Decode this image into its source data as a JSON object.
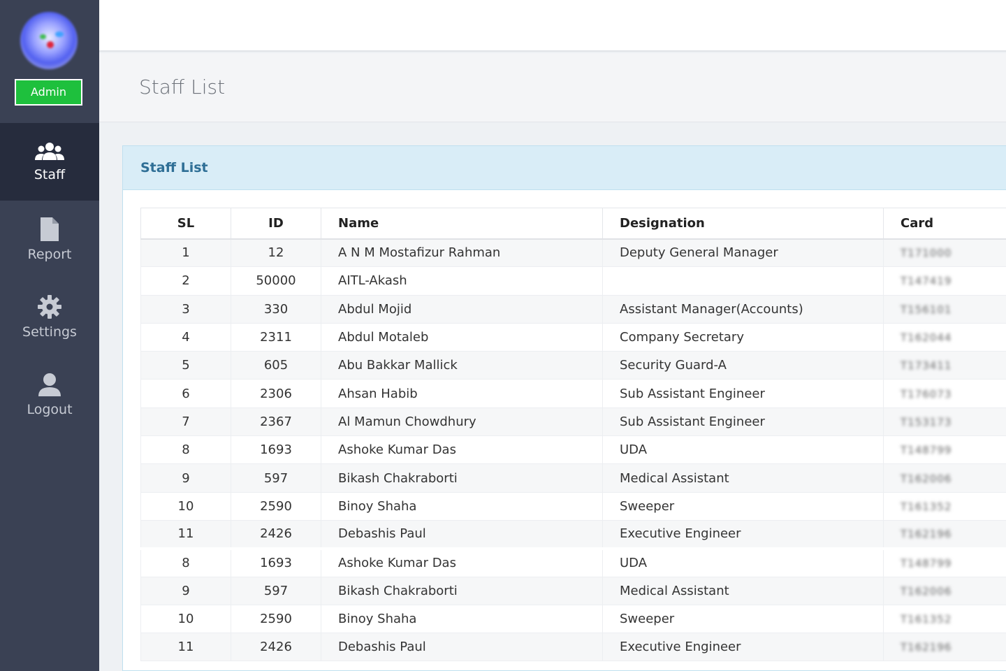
{
  "sidebar": {
    "admin_badge": "Admin",
    "items": [
      {
        "label": "Staff",
        "icon": "users-icon",
        "active": true
      },
      {
        "label": "Report",
        "icon": "file-icon",
        "active": false
      },
      {
        "label": "Settings",
        "icon": "gear-icon",
        "active": false
      },
      {
        "label": "Logout",
        "icon": "user-icon",
        "active": false
      }
    ]
  },
  "page": {
    "title": "Staff List"
  },
  "panel": {
    "title": "Staff List"
  },
  "table": {
    "headers": [
      "SL",
      "ID",
      "Name",
      "Designation",
      "Card"
    ],
    "rows": [
      {
        "sl": "1",
        "id": "12",
        "name": "A N M Mostafizur Rahman",
        "designation": "Deputy General Manager",
        "card": "T171000"
      },
      {
        "sl": "2",
        "id": "50000",
        "name": "AITL-Akash",
        "designation": "",
        "card": "T147419"
      },
      {
        "sl": "3",
        "id": "330",
        "name": "Abdul Mojid",
        "designation": "Assistant Manager(Accounts)",
        "card": "T156101"
      },
      {
        "sl": "4",
        "id": "2311",
        "name": "Abdul Motaleb",
        "designation": "Company Secretary",
        "card": "T162044"
      },
      {
        "sl": "5",
        "id": "605",
        "name": "Abu Bakkar Mallick",
        "designation": "Security Guard-A",
        "card": "T173411"
      },
      {
        "sl": "6",
        "id": "2306",
        "name": "Ahsan Habib",
        "designation": "Sub Assistant Engineer",
        "card": "T176073"
      },
      {
        "sl": "7",
        "id": "2367",
        "name": "Al Mamun Chowdhury",
        "designation": "Sub Assistant Engineer",
        "card": "T153173"
      },
      {
        "sl": "8",
        "id": "1693",
        "name": "Ashoke Kumar Das",
        "designation": "UDA",
        "card": "T148799"
      },
      {
        "sl": "9",
        "id": "597",
        "name": "Bikash Chakraborti",
        "designation": "Medical Assistant",
        "card": "T162006"
      },
      {
        "sl": "10",
        "id": "2590",
        "name": "Binoy Shaha",
        "designation": "Sweeper",
        "card": "T161352"
      },
      {
        "sl": "11",
        "id": "2426",
        "name": "Debashis Paul",
        "designation": "Executive Engineer",
        "card": "T162196"
      },
      {
        "sl": "8",
        "id": "1693",
        "name": "Ashoke Kumar Das",
        "designation": "UDA",
        "card": "T148799"
      },
      {
        "sl": "9",
        "id": "597",
        "name": "Bikash Chakraborti",
        "designation": "Medical Assistant",
        "card": "T162006"
      },
      {
        "sl": "10",
        "id": "2590",
        "name": "Binoy Shaha",
        "designation": "Sweeper",
        "card": "T161352"
      },
      {
        "sl": "11",
        "id": "2426",
        "name": "Debashis Paul",
        "designation": "Executive Engineer",
        "card": "T162196"
      }
    ]
  }
}
